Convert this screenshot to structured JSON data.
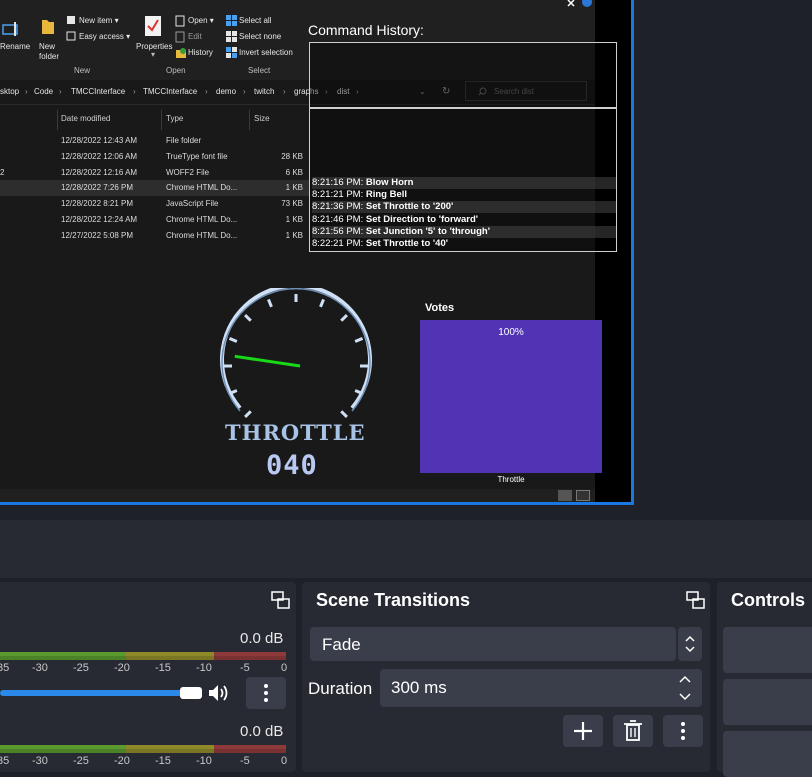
{
  "explorer": {
    "ribbon": {
      "rename": "Rename",
      "new_folder": "New folder",
      "new_item": "New item ▾",
      "easy_access": "Easy access ▾",
      "properties": "Properties",
      "open": "Open ▾",
      "edit": "Edit",
      "history": "History",
      "select_all": "Select all",
      "select_none": "Select none",
      "invert_selection": "Invert selection",
      "group_new": "New",
      "group_open": "Open",
      "group_select": "Select"
    },
    "breadcrumbs": [
      "sktop",
      "Code",
      "TMCCInterface",
      "TMCCInterface",
      "demo",
      "twitch",
      "graphs",
      "dist"
    ],
    "search_placeholder": "Search dist",
    "columns": {
      "date": "Date modified",
      "type": "Type",
      "size": "Size"
    },
    "rows": [
      {
        "prefix": "",
        "date": "12/28/2022 12:43 AM",
        "type": "File folder",
        "size": ""
      },
      {
        "prefix": "",
        "date": "12/28/2022 12:06 AM",
        "type": "TrueType font file",
        "size": "28 KB"
      },
      {
        "prefix": "2",
        "date": "12/28/2022 12:16 AM",
        "type": "WOFF2 File",
        "size": "6 KB"
      },
      {
        "prefix": "",
        "date": "12/28/2022 7:26 PM",
        "type": "Chrome HTML Do...",
        "size": "1 KB"
      },
      {
        "prefix": "",
        "date": "12/28/2022 8:21 PM",
        "type": "JavaScript File",
        "size": "73 KB"
      },
      {
        "prefix": "",
        "date": "12/28/2022 12:24 AM",
        "type": "Chrome HTML Do...",
        "size": "1 KB"
      },
      {
        "prefix": "",
        "date": "12/27/2022 5:08 PM",
        "type": "Chrome HTML Do...",
        "size": "1 KB"
      }
    ]
  },
  "command_history": {
    "title": "Command History:",
    "entries": [
      {
        "time": "8:21:16 PM:",
        "text": "Blow Horn"
      },
      {
        "time": "8:21:21 PM:",
        "text": "Ring Bell"
      },
      {
        "time": "8:21:36 PM:",
        "text": "Set Throttle to '200'"
      },
      {
        "time": "8:21:46 PM:",
        "text": "Set Direction to 'forward'"
      },
      {
        "time": "8:21:56 PM:",
        "text": "Set Junction '5' to 'through'"
      },
      {
        "time": "8:22:21 PM:",
        "text": "Set Throttle to '40'"
      }
    ]
  },
  "throttle": {
    "label": "THROTTLE",
    "value": "040",
    "gauge_level": 0.2
  },
  "votes": {
    "title": "Votes",
    "percent": "100%",
    "category": "Throttle",
    "bar_color": "#5134b4"
  },
  "mixer": {
    "db_1": "0.0 dB",
    "db_2": "0.0 dB",
    "ticks": [
      "35",
      "-30",
      "-25",
      "-20",
      "-15",
      "-10",
      "-5",
      "0"
    ],
    "volume_level": 0.95
  },
  "scene_transitions": {
    "title": "Scene Transitions",
    "transition": "Fade",
    "duration_label": "Duration",
    "duration_value": "300 ms"
  },
  "controls": {
    "title": "Controls"
  },
  "colors": {
    "accent": "#1b77e2",
    "panel": "#272a33",
    "button": "#3a3d4a",
    "votes": "#5134b4"
  }
}
